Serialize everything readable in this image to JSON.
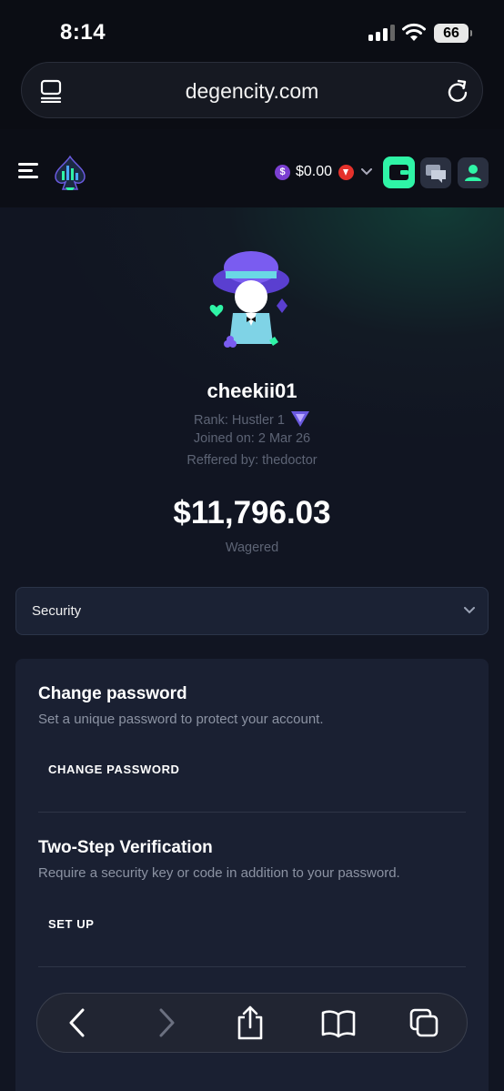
{
  "status": {
    "time": "8:14",
    "battery": "66"
  },
  "browser": {
    "url": "degencity.com"
  },
  "header": {
    "balance": "$0.00",
    "coin_symbol": "$",
    "accent": "#2ff4a6"
  },
  "profile": {
    "username": "cheekii01",
    "rank": "Rank: Hustler 1",
    "joined": "Joined on: 2 Mar 26",
    "referred": "Reffered by: thedoctor",
    "wagered_amount": "$11,796.03",
    "wagered_label": "Wagered"
  },
  "tab_select": {
    "selected": "Security"
  },
  "security": {
    "change_password_title": "Change password",
    "change_password_desc": "Set a unique password to protect your account.",
    "change_password_button": "CHANGE PASSWORD",
    "two_step_title": "Two-Step Verification",
    "two_step_desc": "Require a security key or code in addition to your password.",
    "two_step_button": "SET UP"
  }
}
